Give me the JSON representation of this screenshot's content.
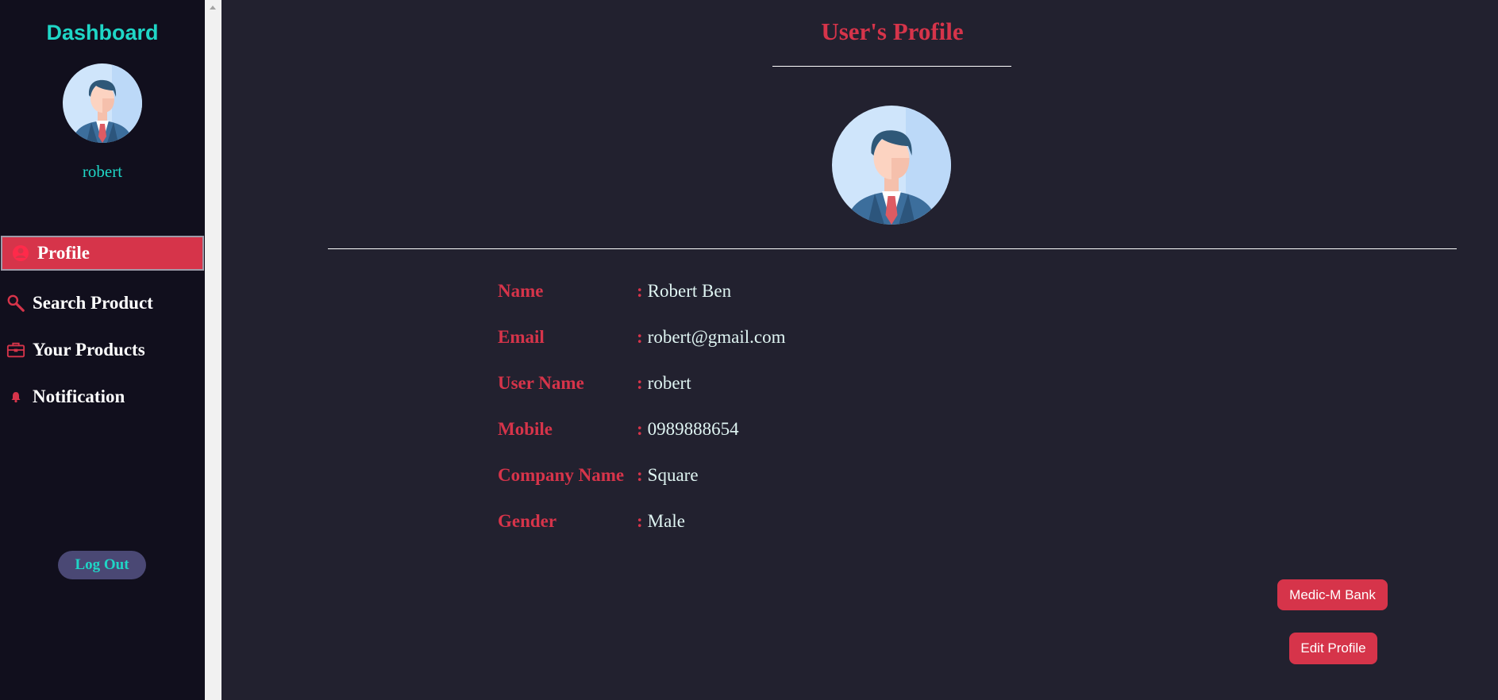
{
  "sidebar": {
    "brand": "Dashboard",
    "username": "robert",
    "nav": [
      {
        "label": "Profile",
        "icon": "user-icon",
        "active": true
      },
      {
        "label": "Search Product",
        "icon": "search-icon"
      },
      {
        "label": "Your Products",
        "icon": "briefcase-icon"
      },
      {
        "label": "Notification",
        "icon": "bell-icon"
      }
    ],
    "logout_label": "Log Out"
  },
  "profile": {
    "title": "User's Profile",
    "fields": [
      {
        "label": "Name",
        "value": "Robert Ben"
      },
      {
        "label": "Email",
        "value": "robert@gmail.com"
      },
      {
        "label": "User Name",
        "value": "robert"
      },
      {
        "label": "Mobile",
        "value": "0989888654"
      },
      {
        "label": "Company Name",
        "value": "Square"
      },
      {
        "label": "Gender",
        "value": "Male"
      }
    ],
    "colon": ":"
  },
  "actions": {
    "bank_label": "Medic-M Bank",
    "edit_label": "Edit Profile"
  },
  "colors": {
    "accent": "#d6344a",
    "teal": "#1fd6c6",
    "sidebar_bg": "#110f1d",
    "main_bg": "#22212f"
  }
}
